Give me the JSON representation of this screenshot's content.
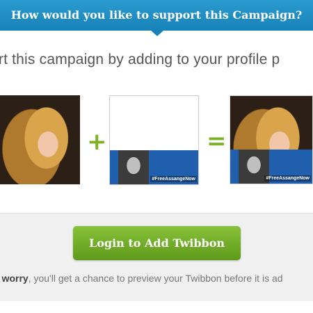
{
  "banner": {
    "title": "How would you like to support this Campaign?"
  },
  "subtitle": "ort this campaign by adding to your profile p",
  "composition": {
    "plus_symbol": "+",
    "equals_symbol": "=",
    "twibbon_tag": "#FreeAssangeNow",
    "result_tag": "#FreeAssangeNow"
  },
  "action": {
    "login_label": "Login to Add Twibbon"
  },
  "note": {
    "lead": "t worry",
    "rest": ", you'll get a chance to preview your Twibbon before it is ad"
  },
  "colors": {
    "banner": "#1782b8",
    "accent_green": "#7cb226",
    "button_green": "#6aa61f",
    "ribbon_blue": "#1f5fae"
  }
}
